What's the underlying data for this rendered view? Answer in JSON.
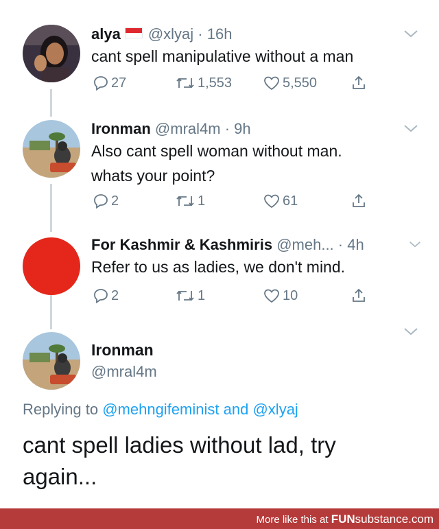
{
  "tweets": [
    {
      "name": "alya",
      "handle": "@xlyaj",
      "time": "· 16h",
      "lines": [
        "cant spell manipulative without a man"
      ],
      "replies": "27",
      "retweets": "1,553",
      "likes": "5,550"
    },
    {
      "name": "Ironman",
      "handle": "@mral4m",
      "time": "· 9h",
      "lines": [
        "Also cant spell woman without man.",
        "whats your point?"
      ],
      "replies": "2",
      "retweets": "1",
      "likes": "61"
    },
    {
      "name": "For Kashmir & Kashmiris",
      "handle": "@meh...",
      "time": "· 4h",
      "lines": [
        "Refer to us as ladies, we don't mind."
      ],
      "replies": "2",
      "retweets": "1",
      "likes": "10"
    }
  ],
  "focused": {
    "name": "Ironman",
    "handle": "@mral4m",
    "replying_prefix": "Replying to",
    "replying_user1": "@mehngifeminist",
    "replying_and": "and",
    "replying_user2": "@xlyaj",
    "text": "cant spell ladies without lad, try again..."
  },
  "footer": {
    "prefix": "More like this at",
    "brand_bold": "FUN",
    "brand_rest": "substance.com"
  },
  "icons": {
    "reply": "reply-icon",
    "retweet": "retweet-icon",
    "like": "heart-icon",
    "share": "share-icon",
    "menu": "chevron-down-icon",
    "flag": "indonesia-flag-icon"
  },
  "colors": {
    "avatar_red": "#e4271a",
    "link": "#1da1f2",
    "secondary_text": "#657786",
    "footer_bg": "#b53a3a"
  }
}
